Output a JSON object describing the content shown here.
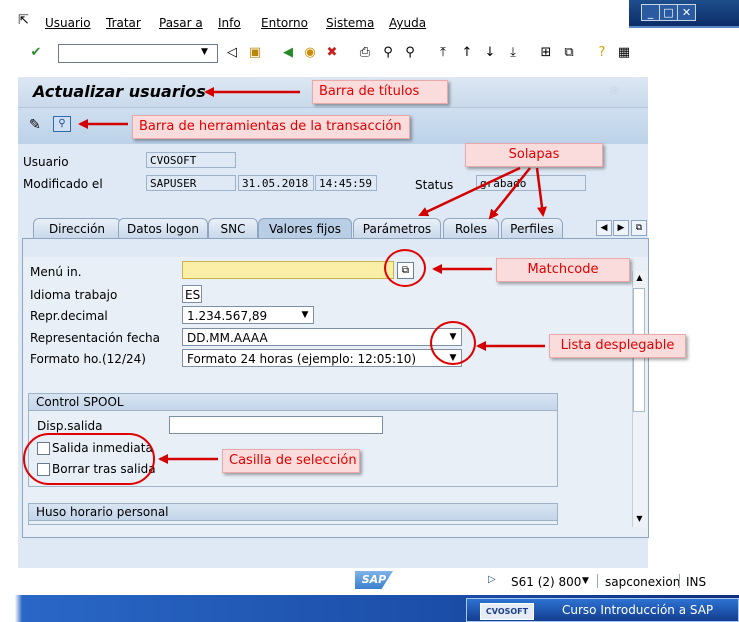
{
  "menu": {
    "items": [
      "Usuario",
      "Tratar",
      "Pasar a",
      "Info",
      "Entorno",
      "Sistema",
      "Ayuda"
    ]
  },
  "title": "Actualizar usuarios",
  "header_fields": {
    "usuario_label": "Usuario",
    "usuario_value": "CVOSOFT",
    "modificado_label": "Modificado el",
    "modificado_user": "SAPUSER",
    "modificado_date": "31.05.2018",
    "modificado_time": "14:45:59",
    "status_label": "Status",
    "status_value": "grabado"
  },
  "tabs": [
    "Dirección",
    "Datos logon",
    "SNC",
    "Valores fijos",
    "Parámetros",
    "Roles",
    "Perfiles"
  ],
  "active_tab": "Valores fijos",
  "form": {
    "menu_inicial_label": "Menú in.",
    "menu_inicial_value": "",
    "idioma_label": "Idioma trabajo",
    "idioma_value": "ES",
    "decimal_label": "Repr.decimal",
    "decimal_value": "1.234.567,89",
    "fecha_label": "Representación fecha",
    "fecha_value": "DD.MM.AAAA",
    "hora_label": "Formato ho.(12/24)",
    "hora_value": "Formato 24 horas (ejemplo: 12:05:10)"
  },
  "spool": {
    "title": "Control SPOOL",
    "disp_label": "Disp.salida",
    "disp_value": "",
    "salida_inmediata": "Salida inmediata",
    "borrar_tras_salida": "Borrar tras salida"
  },
  "huso": {
    "title": "Huso horario personal"
  },
  "annotations": {
    "barra_titulos": "Barra de títulos",
    "barra_herramientas": "Barra de herramientas de la transacción",
    "solapas": "Solapas",
    "matchcode": "Matchcode",
    "lista_desplegable": "Lista desplegable",
    "casilla_seleccion": "Casilla de selección"
  },
  "status_bar": {
    "logo": "SAP",
    "system": "S61 (2) 800",
    "server": "sapconexion",
    "mode": "INS"
  },
  "footer": {
    "brand_logo": "CVOSOFT",
    "course": "Curso Introducción a SAP"
  },
  "colors": {
    "callout_text": "#e00000",
    "callout_bg": "#fbdcdc",
    "arrow": "#d40000",
    "required_field": "#fbefa8"
  }
}
